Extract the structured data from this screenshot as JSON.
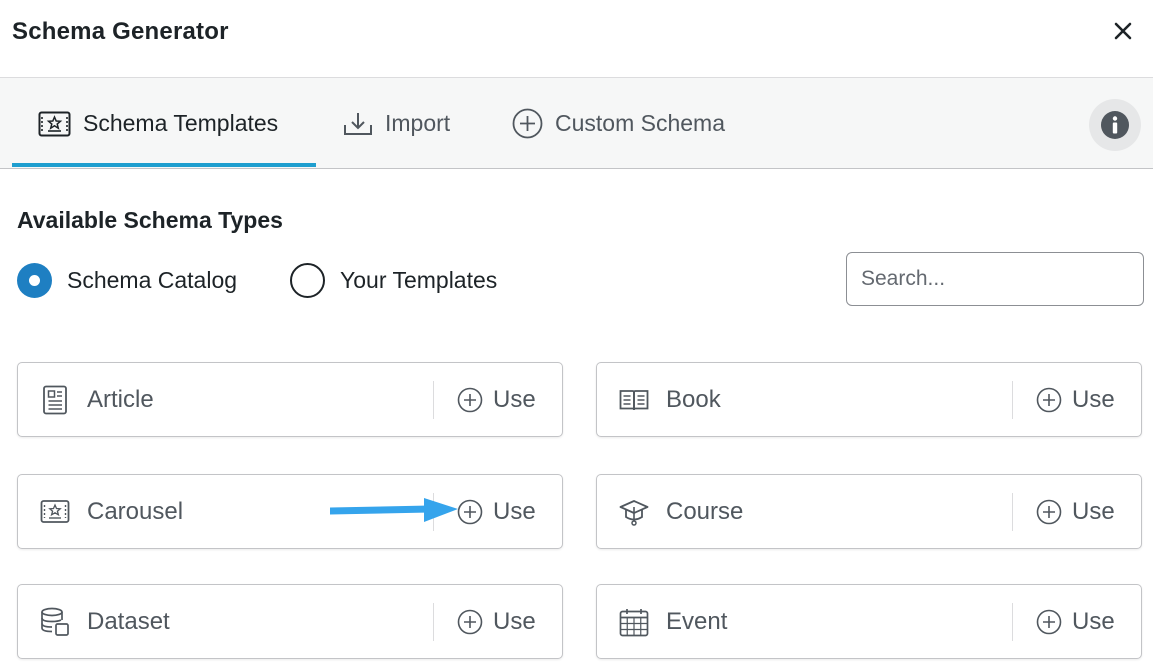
{
  "dialog": {
    "title": "Schema Generator"
  },
  "tabs": [
    {
      "label": "Schema Templates",
      "icon": "template-icon",
      "active": true
    },
    {
      "label": "Import",
      "icon": "import-icon",
      "active": false
    },
    {
      "label": "Custom Schema",
      "icon": "plus-circle-icon",
      "active": false
    }
  ],
  "section": {
    "heading": "Available Schema Types"
  },
  "source": {
    "options": [
      {
        "label": "Schema Catalog",
        "selected": true
      },
      {
        "label": "Your Templates",
        "selected": false
      }
    ]
  },
  "search": {
    "placeholder": "Search...",
    "value": ""
  },
  "schema_types": [
    {
      "name": "Article",
      "icon": "article-icon",
      "action": "Use"
    },
    {
      "name": "Book",
      "icon": "book-icon",
      "action": "Use"
    },
    {
      "name": "Carousel",
      "icon": "carousel-icon",
      "action": "Use"
    },
    {
      "name": "Course",
      "icon": "course-icon",
      "action": "Use"
    },
    {
      "name": "Dataset",
      "icon": "dataset-icon",
      "action": "Use"
    },
    {
      "name": "Event",
      "icon": "event-icon",
      "action": "Use"
    }
  ],
  "colors": {
    "accent": "#1e9ecf",
    "radio_selected": "#1e7fc2",
    "arrow": "#35a4ec",
    "text": "#1d2327",
    "muted": "#50575e"
  }
}
